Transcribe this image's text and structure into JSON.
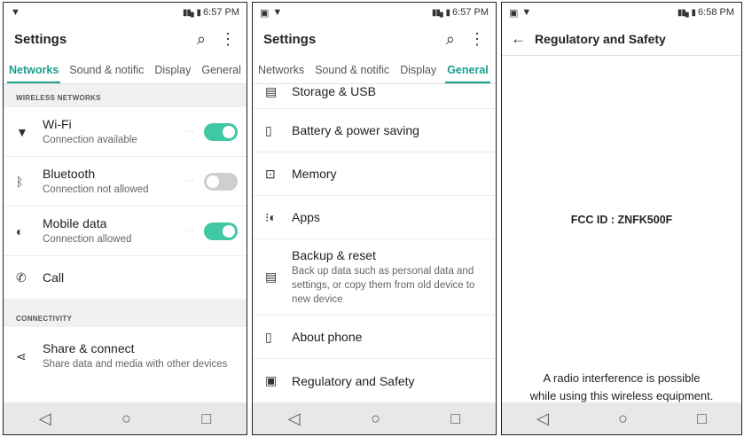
{
  "screen1": {
    "status": {
      "time": "6:57 PM"
    },
    "title": "Settings",
    "tabs": [
      "Networks",
      "Sound & notific",
      "Display",
      "General"
    ],
    "section1": "WIRELESS NETWORKS",
    "items": [
      {
        "label": "Wi-Fi",
        "sub": "Connection available",
        "toggle": "on"
      },
      {
        "label": "Bluetooth",
        "sub": "Connection not allowed",
        "toggle": "off"
      },
      {
        "label": "Mobile data",
        "sub": "Connection allowed",
        "toggle": "on"
      },
      {
        "label": "Call"
      }
    ],
    "section2": "CONNECTIVITY",
    "share": {
      "label": "Share & connect",
      "sub": "Share data and media with other devices"
    }
  },
  "screen2": {
    "status": {
      "time": "6:57 PM"
    },
    "title": "Settings",
    "tabs": [
      "Networks",
      "Sound & notific",
      "Display",
      "General"
    ],
    "items": [
      {
        "label": "Storage & USB"
      },
      {
        "label": "Battery & power saving"
      },
      {
        "label": "Memory"
      },
      {
        "label": "Apps"
      },
      {
        "label": "Backup & reset",
        "sub": "Back up data such as personal data and settings, or copy them from old device to new device"
      },
      {
        "label": "About phone"
      },
      {
        "label": "Regulatory and Safety"
      }
    ]
  },
  "screen3": {
    "status": {
      "time": "6:58 PM"
    },
    "title": "Regulatory and Safety",
    "fcc": "FCC ID : ZNFK500F",
    "notice_line1": "A radio interference is possible",
    "notice_line2": "while using this wireless equipment."
  },
  "icons": {
    "back": "◁",
    "home": "○",
    "recent": "□"
  },
  "colors": {
    "accent": "#1a9e8e",
    "toggle_on": "#40c7a3"
  }
}
